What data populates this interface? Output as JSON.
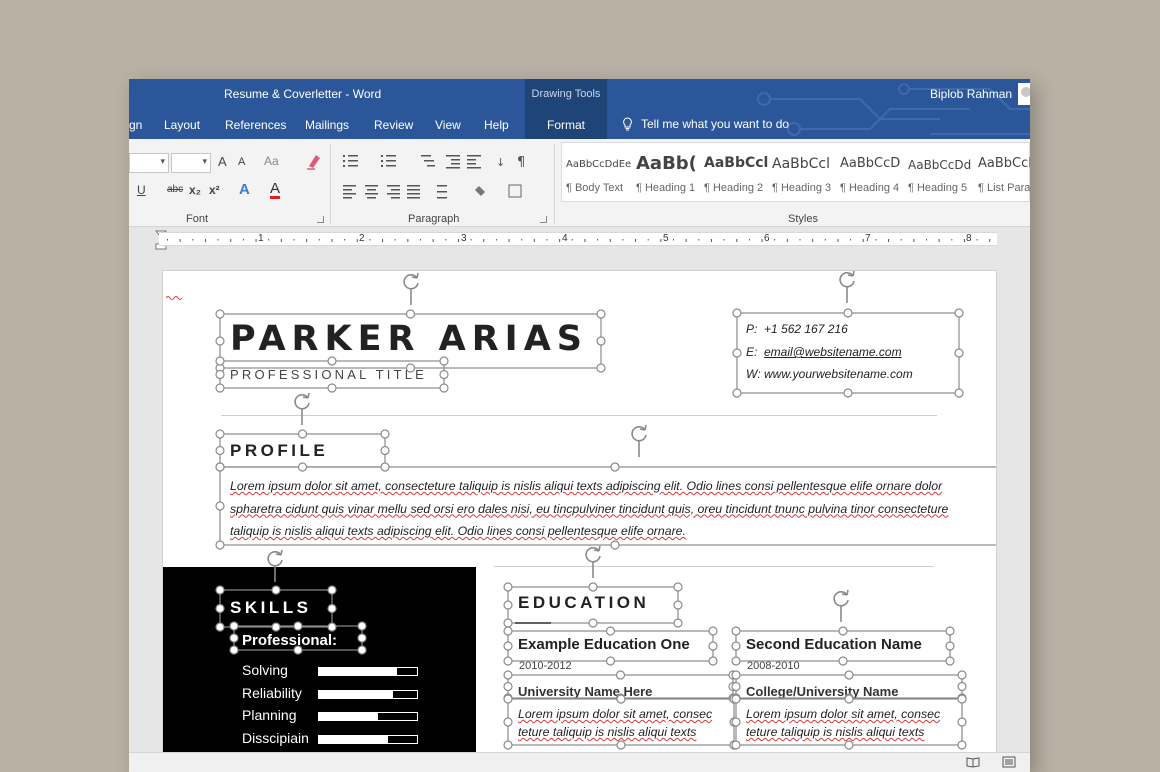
{
  "window": {
    "title": "Resume & Coverletter  -  Word",
    "contextual_tab_group": "Drawing Tools",
    "user_name": "Biplob Rahman",
    "colors": {
      "titlebar": "#2b579a",
      "ribbon": "#f3f3f3",
      "spellcheck": "#d63a3a"
    }
  },
  "tabs": [
    "gn",
    "Layout",
    "References",
    "Mailings",
    "Review",
    "View",
    "Help",
    "Format"
  ],
  "tell_me": "Tell me what you want to do",
  "ribbon": {
    "groups": {
      "font": "Font",
      "paragraph": "Paragraph",
      "styles": "Styles"
    },
    "font_buttons": {
      "grow": "A",
      "shrink": "A",
      "case": "Aa",
      "underline": "U",
      "strike": "abc",
      "subscript": "x₂",
      "superscript": "x²",
      "effects": "A",
      "color": "A"
    },
    "styles": [
      {
        "preview": "AaBbCcDdEe",
        "name": "¶ Body Text"
      },
      {
        "preview": "AaBb(",
        "name": "¶ Heading 1"
      },
      {
        "preview": "AaBbCcl",
        "name": "¶ Heading 2"
      },
      {
        "preview": "AaBbCcl",
        "name": "¶ Heading 3"
      },
      {
        "preview": "AaBbCcD",
        "name": "¶ Heading 4"
      },
      {
        "preview": "AaBbCcDd",
        "name": "¶ Heading 5"
      },
      {
        "preview": "AaBbCcl",
        "name": "¶ List Para"
      }
    ]
  },
  "ruler": {
    "numbers": [
      "1",
      "2",
      "3",
      "4",
      "5",
      "6",
      "7",
      "8"
    ]
  },
  "resume": {
    "name": "PARKER ARIAS",
    "title": "PROFESSIONAL TITLE",
    "contact": [
      {
        "label": "P:",
        "value": "+1 562 167 216"
      },
      {
        "label": "E:",
        "value": "email@websitename.com"
      },
      {
        "label": "W:",
        "value": "www.yourwebsitename.com"
      }
    ],
    "profile": {
      "heading": "PROFILE",
      "text": "Lorem ipsum dolor sit amet, consecteture taliquip is nislis aliqui texts adipiscing elit. Odio lines consi pellentesque elife ornare dolor spharetra cidunt quis vinar mellu sed orsi ero dales nisi, eu tincpulviner tincidunt quis, oreu tincidunt tnunc pulvina tinor consecteture taliquip is nislis aliqui texts adipiscing elit. Odio lines consi pellentesque elife ornare."
    },
    "skills": {
      "heading": "SKILLS",
      "subheading": "Professional:",
      "items": [
        {
          "label": "Solving",
          "level": 0.8
        },
        {
          "label": "Reliability",
          "level": 0.75
        },
        {
          "label": "Planning",
          "level": 0.6
        },
        {
          "label": "Disscipiain",
          "level": 0.7
        }
      ]
    },
    "education": {
      "heading": "EDUCATION",
      "entries": [
        {
          "name": "Example Education One",
          "years": "2010-2012",
          "school": "University Name Here",
          "desc": "Lorem ipsum dolor sit amet, consec teture taliquip is nislis aliqui texts"
        },
        {
          "name": "Second Education Name",
          "years": "2008-2010",
          "school": "College/University Name",
          "desc": "Lorem ipsum dolor sit amet, consec teture taliquip is nislis aliqui texts"
        }
      ]
    }
  }
}
